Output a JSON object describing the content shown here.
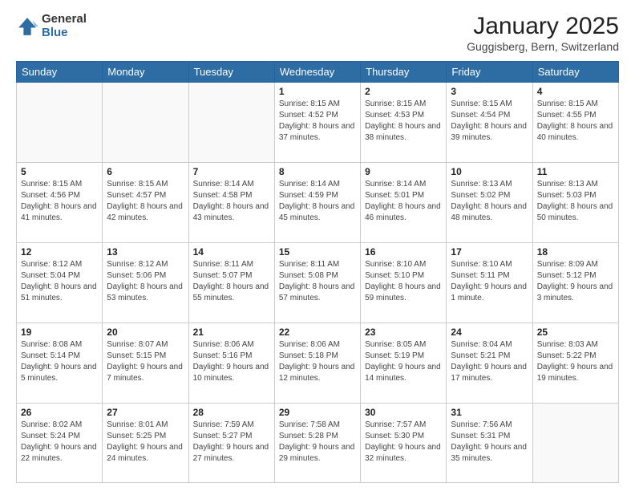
{
  "logo": {
    "general": "General",
    "blue": "Blue"
  },
  "header": {
    "month": "January 2025",
    "location": "Guggisberg, Bern, Switzerland"
  },
  "weekdays": [
    "Sunday",
    "Monday",
    "Tuesday",
    "Wednesday",
    "Thursday",
    "Friday",
    "Saturday"
  ],
  "weeks": [
    [
      {
        "day": "",
        "info": ""
      },
      {
        "day": "",
        "info": ""
      },
      {
        "day": "",
        "info": ""
      },
      {
        "day": "1",
        "info": "Sunrise: 8:15 AM\nSunset: 4:52 PM\nDaylight: 8 hours and 37 minutes."
      },
      {
        "day": "2",
        "info": "Sunrise: 8:15 AM\nSunset: 4:53 PM\nDaylight: 8 hours and 38 minutes."
      },
      {
        "day": "3",
        "info": "Sunrise: 8:15 AM\nSunset: 4:54 PM\nDaylight: 8 hours and 39 minutes."
      },
      {
        "day": "4",
        "info": "Sunrise: 8:15 AM\nSunset: 4:55 PM\nDaylight: 8 hours and 40 minutes."
      }
    ],
    [
      {
        "day": "5",
        "info": "Sunrise: 8:15 AM\nSunset: 4:56 PM\nDaylight: 8 hours and 41 minutes."
      },
      {
        "day": "6",
        "info": "Sunrise: 8:15 AM\nSunset: 4:57 PM\nDaylight: 8 hours and 42 minutes."
      },
      {
        "day": "7",
        "info": "Sunrise: 8:14 AM\nSunset: 4:58 PM\nDaylight: 8 hours and 43 minutes."
      },
      {
        "day": "8",
        "info": "Sunrise: 8:14 AM\nSunset: 4:59 PM\nDaylight: 8 hours and 45 minutes."
      },
      {
        "day": "9",
        "info": "Sunrise: 8:14 AM\nSunset: 5:01 PM\nDaylight: 8 hours and 46 minutes."
      },
      {
        "day": "10",
        "info": "Sunrise: 8:13 AM\nSunset: 5:02 PM\nDaylight: 8 hours and 48 minutes."
      },
      {
        "day": "11",
        "info": "Sunrise: 8:13 AM\nSunset: 5:03 PM\nDaylight: 8 hours and 50 minutes."
      }
    ],
    [
      {
        "day": "12",
        "info": "Sunrise: 8:12 AM\nSunset: 5:04 PM\nDaylight: 8 hours and 51 minutes."
      },
      {
        "day": "13",
        "info": "Sunrise: 8:12 AM\nSunset: 5:06 PM\nDaylight: 8 hours and 53 minutes."
      },
      {
        "day": "14",
        "info": "Sunrise: 8:11 AM\nSunset: 5:07 PM\nDaylight: 8 hours and 55 minutes."
      },
      {
        "day": "15",
        "info": "Sunrise: 8:11 AM\nSunset: 5:08 PM\nDaylight: 8 hours and 57 minutes."
      },
      {
        "day": "16",
        "info": "Sunrise: 8:10 AM\nSunset: 5:10 PM\nDaylight: 8 hours and 59 minutes."
      },
      {
        "day": "17",
        "info": "Sunrise: 8:10 AM\nSunset: 5:11 PM\nDaylight: 9 hours and 1 minute."
      },
      {
        "day": "18",
        "info": "Sunrise: 8:09 AM\nSunset: 5:12 PM\nDaylight: 9 hours and 3 minutes."
      }
    ],
    [
      {
        "day": "19",
        "info": "Sunrise: 8:08 AM\nSunset: 5:14 PM\nDaylight: 9 hours and 5 minutes."
      },
      {
        "day": "20",
        "info": "Sunrise: 8:07 AM\nSunset: 5:15 PM\nDaylight: 9 hours and 7 minutes."
      },
      {
        "day": "21",
        "info": "Sunrise: 8:06 AM\nSunset: 5:16 PM\nDaylight: 9 hours and 10 minutes."
      },
      {
        "day": "22",
        "info": "Sunrise: 8:06 AM\nSunset: 5:18 PM\nDaylight: 9 hours and 12 minutes."
      },
      {
        "day": "23",
        "info": "Sunrise: 8:05 AM\nSunset: 5:19 PM\nDaylight: 9 hours and 14 minutes."
      },
      {
        "day": "24",
        "info": "Sunrise: 8:04 AM\nSunset: 5:21 PM\nDaylight: 9 hours and 17 minutes."
      },
      {
        "day": "25",
        "info": "Sunrise: 8:03 AM\nSunset: 5:22 PM\nDaylight: 9 hours and 19 minutes."
      }
    ],
    [
      {
        "day": "26",
        "info": "Sunrise: 8:02 AM\nSunset: 5:24 PM\nDaylight: 9 hours and 22 minutes."
      },
      {
        "day": "27",
        "info": "Sunrise: 8:01 AM\nSunset: 5:25 PM\nDaylight: 9 hours and 24 minutes."
      },
      {
        "day": "28",
        "info": "Sunrise: 7:59 AM\nSunset: 5:27 PM\nDaylight: 9 hours and 27 minutes."
      },
      {
        "day": "29",
        "info": "Sunrise: 7:58 AM\nSunset: 5:28 PM\nDaylight: 9 hours and 29 minutes."
      },
      {
        "day": "30",
        "info": "Sunrise: 7:57 AM\nSunset: 5:30 PM\nDaylight: 9 hours and 32 minutes."
      },
      {
        "day": "31",
        "info": "Sunrise: 7:56 AM\nSunset: 5:31 PM\nDaylight: 9 hours and 35 minutes."
      },
      {
        "day": "",
        "info": ""
      }
    ]
  ]
}
